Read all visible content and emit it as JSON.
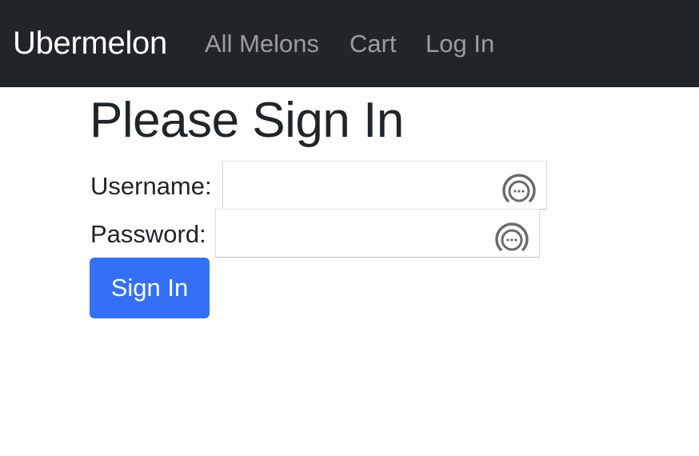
{
  "navbar": {
    "brand": "Ubermelon",
    "links": [
      {
        "label": "All Melons"
      },
      {
        "label": "Cart"
      },
      {
        "label": "Log In"
      }
    ]
  },
  "main": {
    "title": "Please Sign In",
    "username": {
      "label": "Username:",
      "value": "",
      "placeholder": ""
    },
    "password": {
      "label": "Password:",
      "value": "",
      "placeholder": ""
    },
    "submit_label": "Sign In"
  },
  "icons": {
    "password_manager": "password-manager-icon"
  },
  "colors": {
    "navbar_bg": "#212529",
    "brand_text": "#ffffff",
    "nav_link_text": "#9a9da0",
    "button_bg": "#3370f5",
    "text": "#212529"
  }
}
